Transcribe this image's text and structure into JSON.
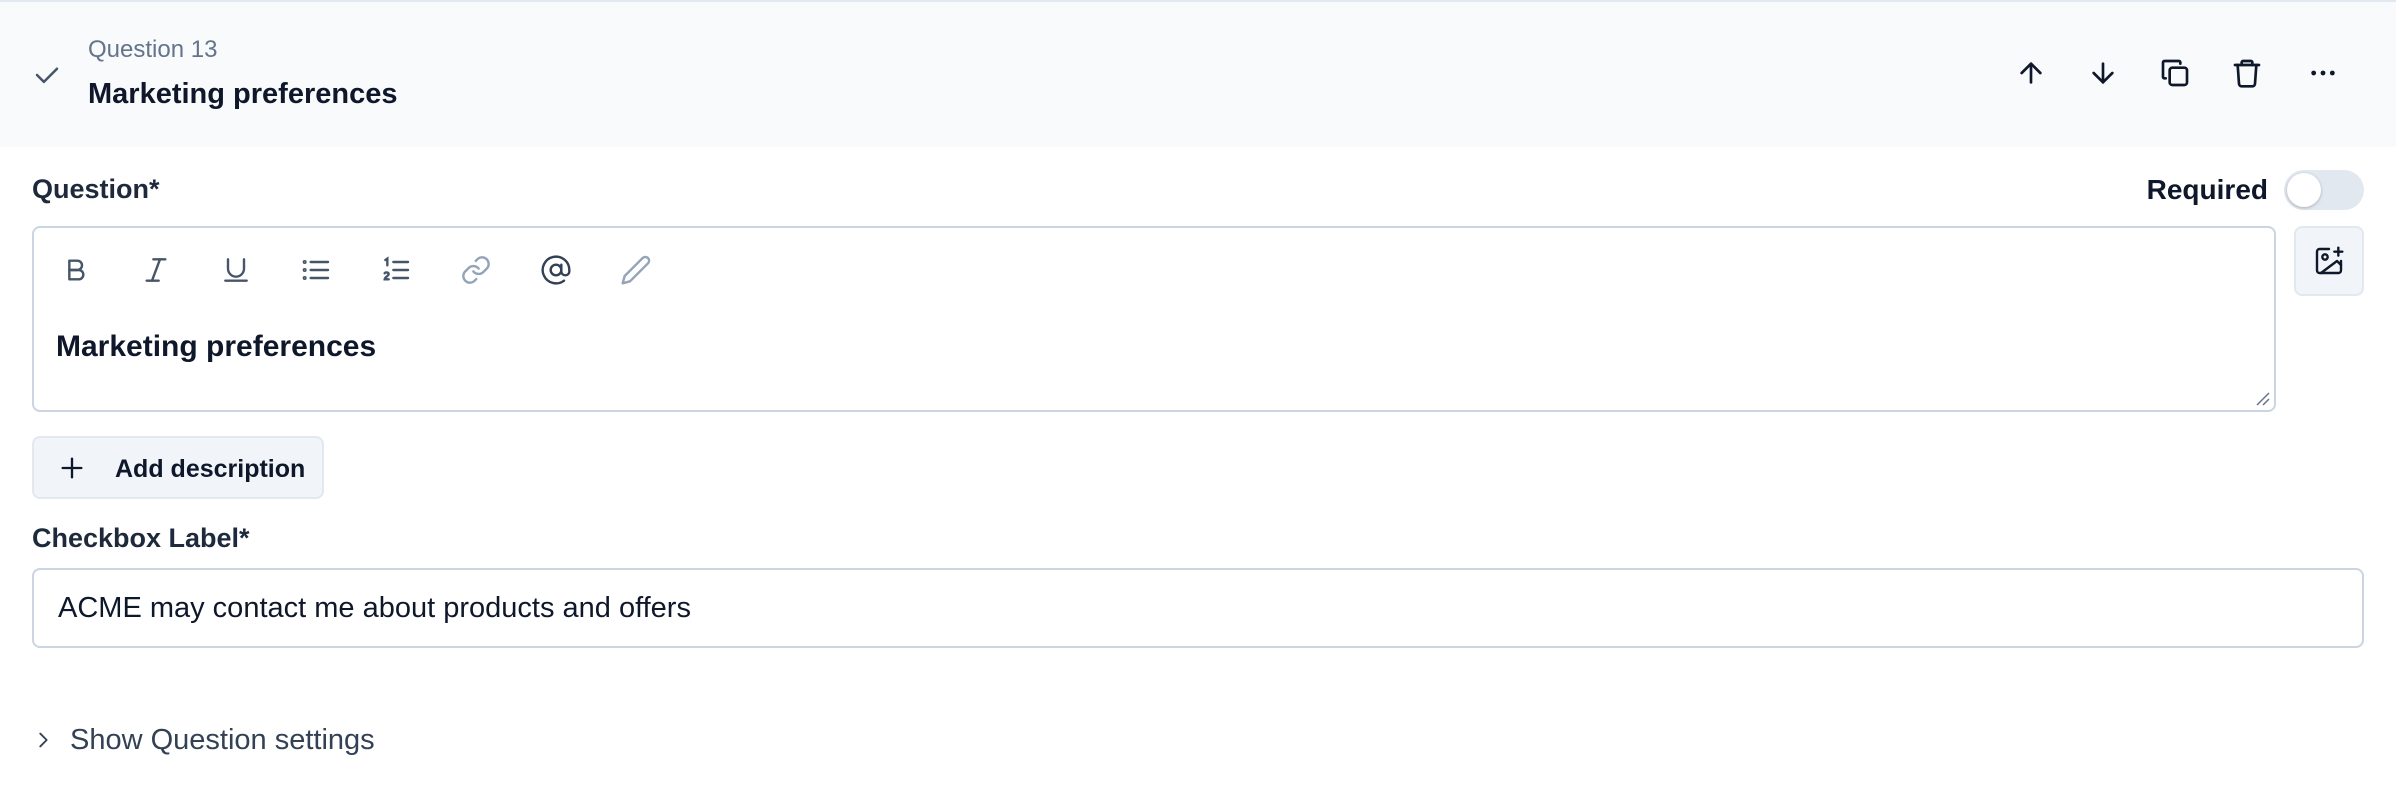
{
  "header": {
    "question_number": "Question 13",
    "question_title": "Marketing preferences",
    "actions": [
      "move-up",
      "move-down",
      "duplicate",
      "delete",
      "more"
    ]
  },
  "question_field": {
    "label": "Question*",
    "required_label": "Required",
    "required": false,
    "content": "Marketing preferences",
    "toolbar": [
      "bold",
      "italic",
      "underline",
      "bullet-list",
      "numbered-list",
      "link",
      "mention",
      "highlight"
    ]
  },
  "add_description": {
    "label": "Add description"
  },
  "checkbox_label": {
    "label": "Checkbox Label*",
    "value": "ACME may contact me about products and offers"
  },
  "settings_toggle": {
    "label": "Show Question settings"
  },
  "colors": {
    "header_bg": "#f8fafc",
    "border": "#cbd5e1",
    "muted": "#64748b",
    "text": "#0f172a"
  }
}
